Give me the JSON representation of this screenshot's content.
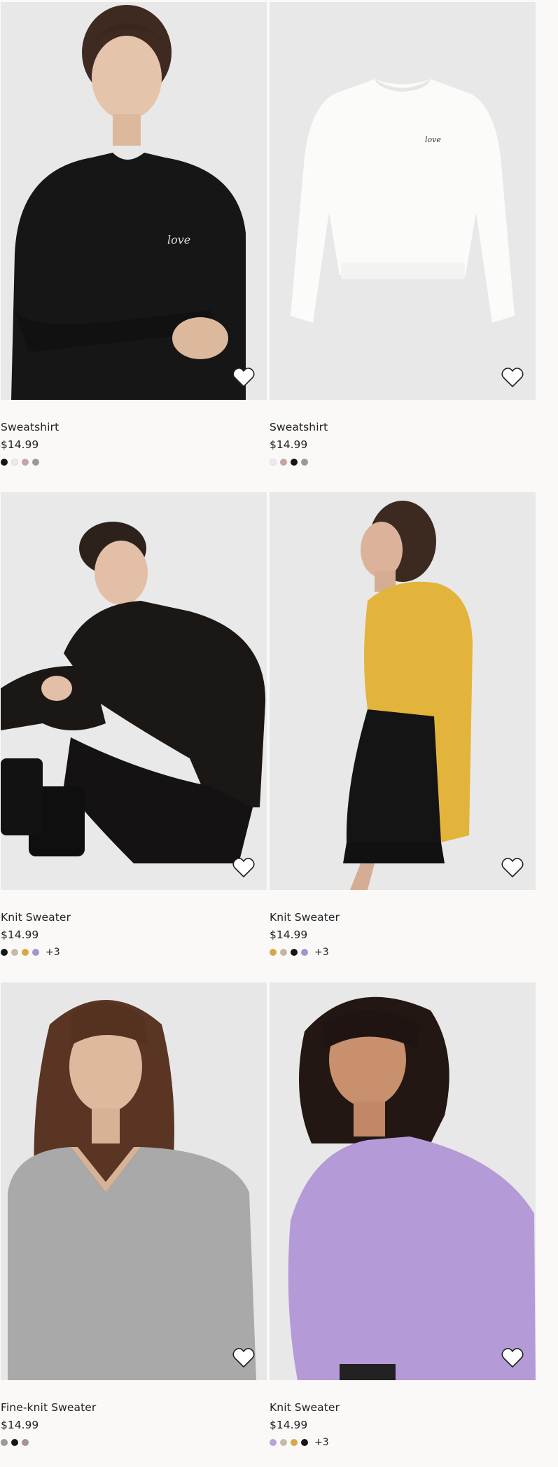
{
  "products": [
    {
      "name": "Sweatshirt",
      "price": "$14.99",
      "colors": [
        "#151515",
        "#ede8ec",
        "#c9a3a4",
        "#9a9a98"
      ],
      "more": ""
    },
    {
      "name": "Sweatshirt",
      "price": "$14.99",
      "colors": [
        "#eceaf0",
        "#c9a3a4",
        "#151515",
        "#9a9a98"
      ],
      "more": ""
    },
    {
      "name": "Knit Sweater",
      "price": "$14.99",
      "colors": [
        "#151515",
        "#c9b9a9",
        "#d7a84a",
        "#a892d0"
      ],
      "more": "+3"
    },
    {
      "name": "Knit Sweater",
      "price": "$14.99",
      "colors": [
        "#d7a84a",
        "#c6b3a8",
        "#151515",
        "#a892d0"
      ],
      "more": "+3"
    },
    {
      "name": "Fine-knit Sweater",
      "price": "$14.99",
      "colors": [
        "#9a9a98",
        "#151515",
        "#a39391"
      ],
      "more": ""
    },
    {
      "name": "Knit Sweater",
      "price": "$14.99",
      "colors": [
        "#b8a2d6",
        "#c6b9aa",
        "#d7a84a",
        "#151515"
      ],
      "more": "+3"
    }
  ],
  "icons": {
    "favorite": "heart-outline-icon"
  }
}
